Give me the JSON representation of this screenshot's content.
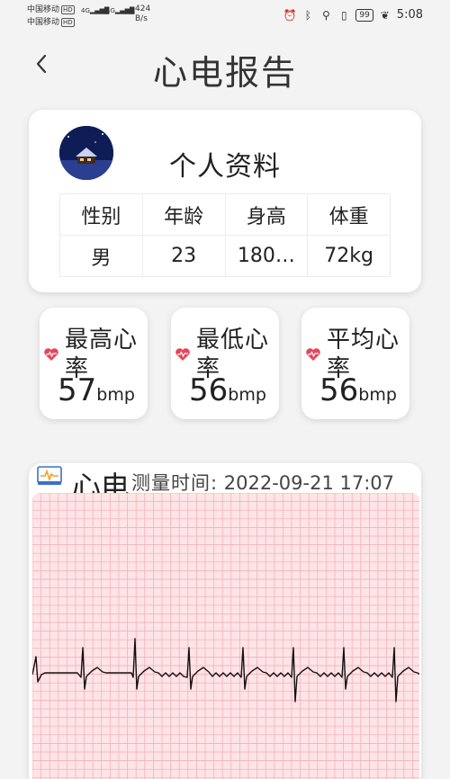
{
  "status_bar": {
    "carrier_1": "中国移动",
    "carrier_2": "中国移动",
    "hd": "HD",
    "signal": "4G",
    "net_speed_value": "424",
    "net_speed_unit": "B/s",
    "battery": "99",
    "time": "5:08"
  },
  "header": {
    "back_icon": "chevron-left-icon",
    "title": "心电报告"
  },
  "profile": {
    "title": "个人资料",
    "headers": [
      "性别",
      "年龄",
      "身高",
      "体重"
    ],
    "values": [
      "男",
      "23",
      "180…",
      "72kg"
    ]
  },
  "rates": [
    {
      "label": "最高心率",
      "value": "57",
      "unit": "bmp"
    },
    {
      "label": "最低心率",
      "value": "56",
      "unit": "bmp"
    },
    {
      "label": "平均心率",
      "value": "56",
      "unit": "bmp"
    }
  ],
  "ecg": {
    "title": "心电",
    "time_label": "测量时间:",
    "time_value": "2022-09-21 17:07"
  },
  "colors": {
    "grid_bg": "#fde4e7",
    "grid_line": "#f4aab3",
    "heart": "#e5475a",
    "trace": "#111111"
  }
}
